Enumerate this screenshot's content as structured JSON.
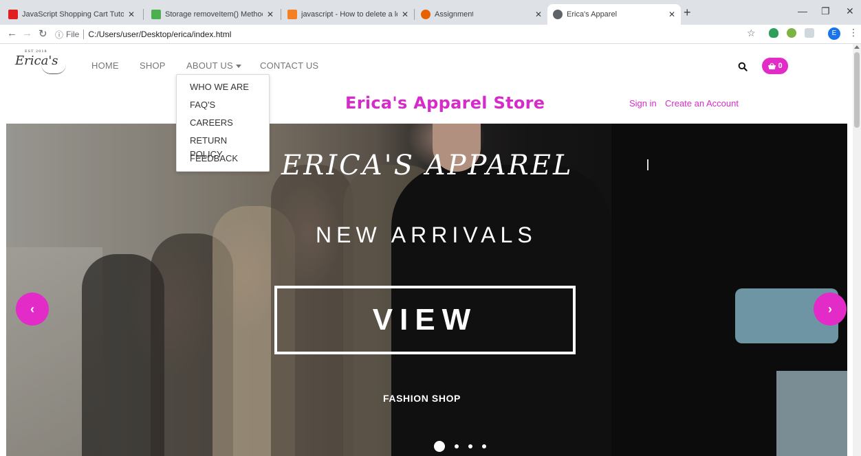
{
  "browser": {
    "tabs": [
      {
        "title": "JavaScript Shopping Cart Tutoria",
        "favicon_color": "#e02020"
      },
      {
        "title": "Storage removeItem() Method",
        "favicon_color": "#4caf50"
      },
      {
        "title": "javascript - How to delete a local",
        "favicon_color": "#f48024"
      },
      {
        "title": "Assignment",
        "favicon_color": "#e66000"
      },
      {
        "title": "Erica's Apparel",
        "favicon_color": "#5f6368"
      }
    ],
    "new_tab": "+",
    "file_label": "File",
    "url": "C:/Users/user/Desktop/erica/index.html",
    "profile_initial": "E"
  },
  "header": {
    "logo_text": "Erica's",
    "logo_small": "EST 2018",
    "nav": [
      {
        "label": "HOME"
      },
      {
        "label": "SHOP"
      },
      {
        "label": "ABOUT US"
      },
      {
        "label": "CONTACT US"
      }
    ],
    "cart_count": "0",
    "store_title": "Erica's Apparel Store",
    "sign_in": "Sign in",
    "create_account": "Create an Account"
  },
  "dropdown": {
    "items": [
      {
        "label": "WHO WE ARE"
      },
      {
        "label": "FAQ'S"
      },
      {
        "label": "CAREERS"
      },
      {
        "label": "RETURN POLICY"
      },
      {
        "label": "FEEDBACK"
      }
    ]
  },
  "hero": {
    "script_title": "ERICA'S APPAREL",
    "subtitle": "NEW ARRIVALS",
    "button_label": "VIEW",
    "tagline": "FASHION SHOP",
    "prev_symbol": "‹",
    "next_symbol": "›",
    "slide_count": 4,
    "active_slide": 1
  },
  "colors": {
    "accent": "#e32bc7",
    "title": "#d52bc9"
  },
  "icons": {
    "search": "search-icon",
    "cart": "basket-icon",
    "prev": "chevron-left-icon",
    "next": "chevron-right-icon"
  }
}
